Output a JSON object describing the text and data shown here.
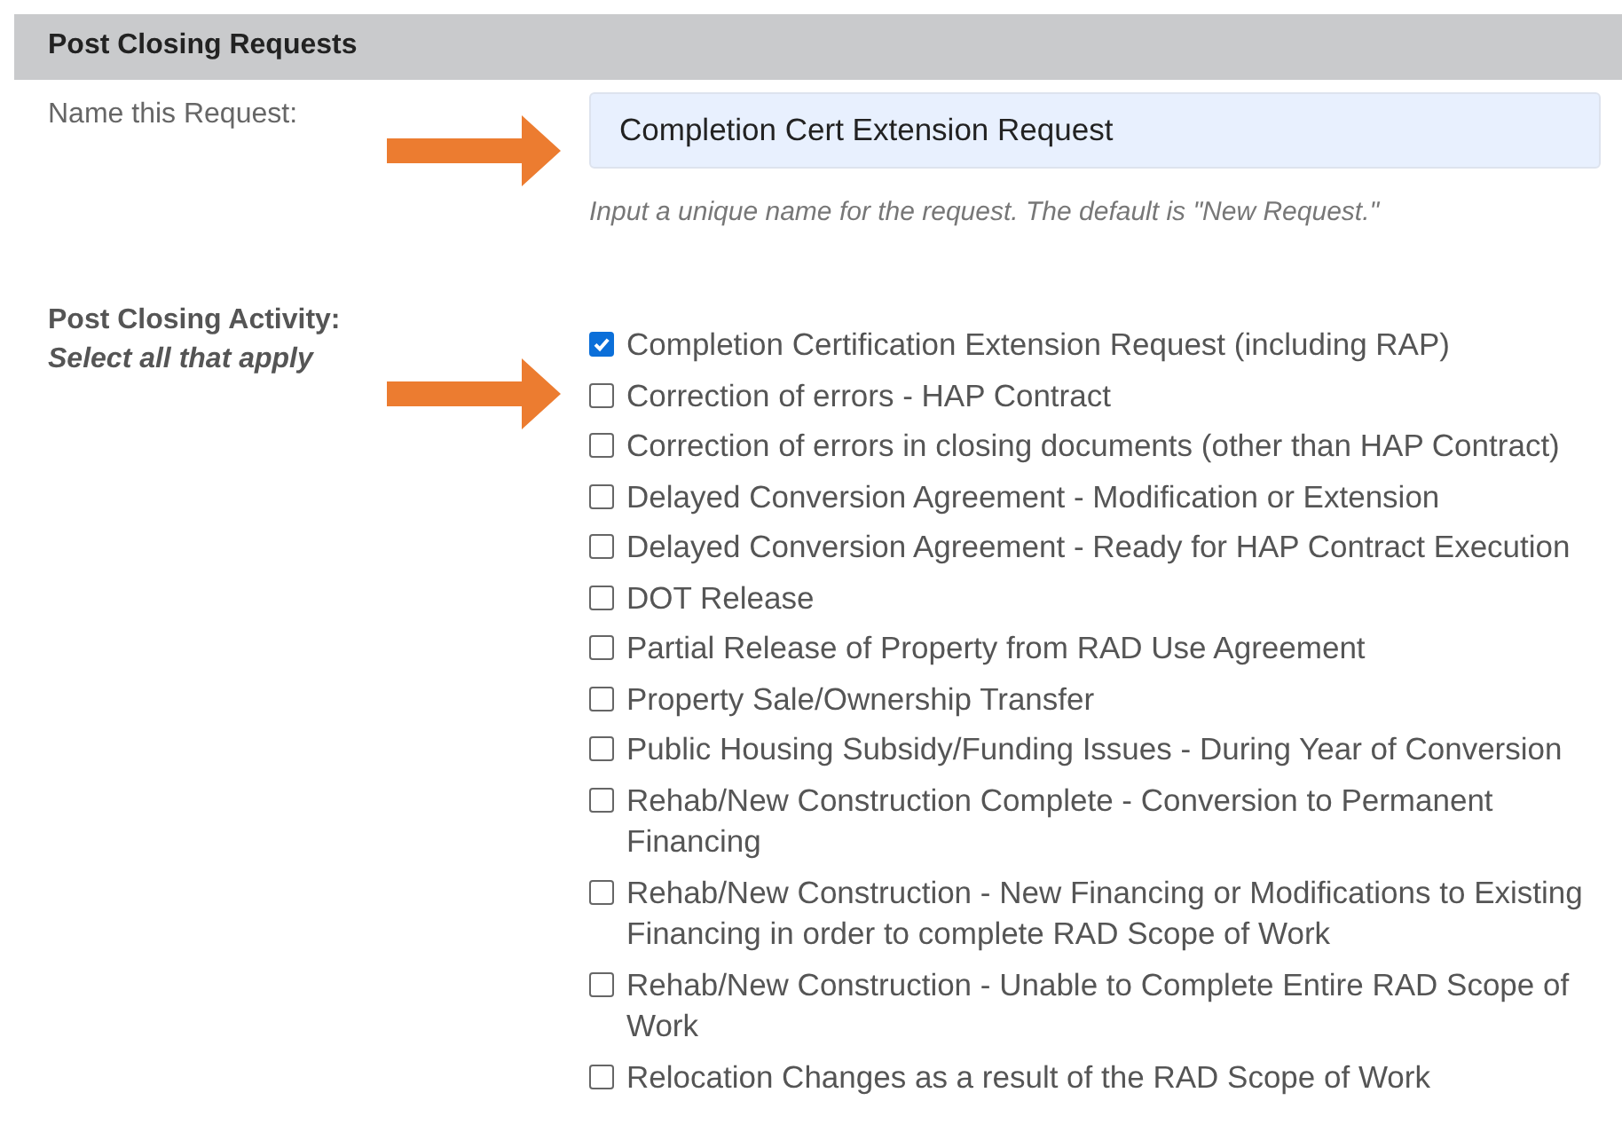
{
  "section": {
    "title": "Post Closing Requests"
  },
  "name_field": {
    "label": "Name this Request:",
    "value": "Completion Cert Extension Request",
    "hint": "Input a unique name for the request. The default is \"New Request.\""
  },
  "activity": {
    "label": "Post Closing Activity:",
    "sublabel": "Select all that apply",
    "options": [
      {
        "label": "Completion Certification Extension Request (including RAP)",
        "checked": true
      },
      {
        "label": "Correction of errors - HAP Contract",
        "checked": false
      },
      {
        "label": "Correction of errors in closing documents (other than HAP Contract)",
        "checked": false
      },
      {
        "label": "Delayed Conversion Agreement - Modification or Extension",
        "checked": false
      },
      {
        "label": "Delayed Conversion Agreement - Ready for HAP Contract Execution",
        "checked": false
      },
      {
        "label": "DOT Release",
        "checked": false
      },
      {
        "label": "Partial Release of Property from RAD Use Agreement",
        "checked": false
      },
      {
        "label": "Property Sale/Ownership Transfer",
        "checked": false
      },
      {
        "label": "Public Housing Subsidy/Funding Issues - During Year of Conversion",
        "checked": false
      },
      {
        "label": "Rehab/New Construction Complete - Conversion to Permanent Financing",
        "checked": false
      },
      {
        "label": "Rehab/New Construction - New Financing or Modifications to Existing Financing in order to complete RAD Scope of Work",
        "checked": false
      },
      {
        "label": "Rehab/New Construction - Unable to Complete Entire RAD Scope of Work",
        "checked": false
      },
      {
        "label": "Relocation Changes as a result of the RAD Scope of Work",
        "checked": false
      }
    ]
  }
}
